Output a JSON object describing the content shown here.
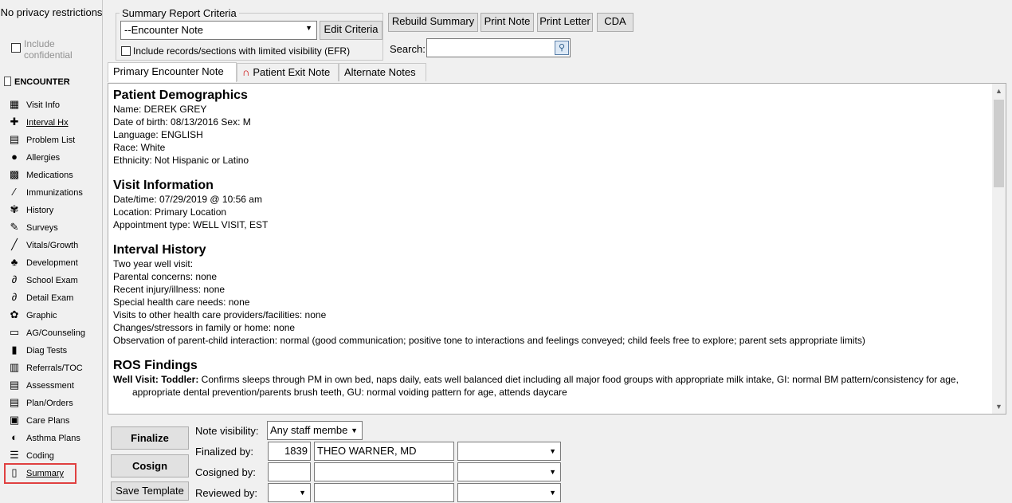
{
  "sidebar": {
    "privacy_text": "No privacy restrictions",
    "include_confidential": "Include confidential",
    "section_title": "ENCOUNTER",
    "items": [
      {
        "label": "Visit Info",
        "icon": "visit-info-icon",
        "glyph": "▦"
      },
      {
        "label": "Interval Hx",
        "icon": "interval-hx-icon",
        "glyph": "✚"
      },
      {
        "label": "Problem List",
        "icon": "problem-list-icon",
        "glyph": "▤"
      },
      {
        "label": "Allergies",
        "icon": "allergies-icon",
        "glyph": "●"
      },
      {
        "label": "Medications",
        "icon": "medications-icon",
        "glyph": "▩"
      },
      {
        "label": "Immunizations",
        "icon": "immunizations-icon",
        "glyph": "⁄"
      },
      {
        "label": "History",
        "icon": "history-icon",
        "glyph": "✾"
      },
      {
        "label": "Surveys",
        "icon": "surveys-icon",
        "glyph": "✎"
      },
      {
        "label": "Vitals/Growth",
        "icon": "vitals-icon",
        "glyph": "╱"
      },
      {
        "label": "Development",
        "icon": "development-icon",
        "glyph": "♣"
      },
      {
        "label": "School Exam",
        "icon": "stethoscope-icon",
        "glyph": "∂"
      },
      {
        "label": "Detail Exam",
        "icon": "stethoscope-icon",
        "glyph": "∂"
      },
      {
        "label": "Graphic",
        "icon": "graphic-icon",
        "glyph": "✿"
      },
      {
        "label": "AG/Counseling",
        "icon": "counseling-icon",
        "glyph": "▭"
      },
      {
        "label": "Diag Tests",
        "icon": "test-tubes-icon",
        "glyph": "▮"
      },
      {
        "label": "Referrals/TOC",
        "icon": "referrals-icon",
        "glyph": "▥"
      },
      {
        "label": "Assessment",
        "icon": "assessment-icon",
        "glyph": "▤"
      },
      {
        "label": "Plan/Orders",
        "icon": "plan-orders-icon",
        "glyph": "▤"
      },
      {
        "label": "Care Plans",
        "icon": "care-plans-icon",
        "glyph": "▣"
      },
      {
        "label": "Asthma Plans",
        "icon": "asthma-plans-icon",
        "glyph": "◐"
      },
      {
        "label": "Coding",
        "icon": "coding-icon",
        "glyph": "☰"
      },
      {
        "label": "Summary",
        "icon": "summary-icon",
        "glyph": "▯"
      }
    ]
  },
  "criteria": {
    "legend": "Summary Report Criteria",
    "selected": "--Encounter Note",
    "edit_button": "Edit Criteria",
    "efr_label": "Include records/sections with limited visibility (EFR)"
  },
  "toolbar": {
    "rebuild": "Rebuild Summary",
    "print_note": "Print Note",
    "print_letter": "Print Letter",
    "cda": "CDA",
    "search_label": "Search:"
  },
  "tabs": {
    "primary": "Primary Encounter Note",
    "exit": "Patient Exit Note",
    "alternate": "Alternate Notes"
  },
  "note": {
    "demographics": {
      "title": "Patient Demographics",
      "name": "Name: DEREK GREY",
      "dob": "Date of birth: 08/13/2016   Sex: M",
      "language": "Language: ENGLISH",
      "race": "Race: White",
      "ethnicity": "Ethnicity: Not Hispanic or Latino"
    },
    "visit": {
      "title": "Visit Information",
      "datetime": "Date/time: 07/29/2019 @ 10:56 am",
      "location": "Location: Primary Location",
      "appt": "Appointment type: WELL VISIT, EST"
    },
    "interval": {
      "title": "Interval History",
      "l1": "Two year well visit:",
      "l2": "Parental concerns: none",
      "l3": "Recent injury/illness: none",
      "l4": "Special health care needs:  none",
      "l5": "Visits to other health care providers/facilities:  none",
      "l6": "Changes/stressors in family or home: none",
      "l7": "Observation of parent-child interaction: normal (good communication; positive tone to interactions and feelings conveyed; child feels free to explore; parent sets appropriate limits)"
    },
    "ros": {
      "title": "ROS Findings",
      "bold": "Well Visit: Toddler:",
      "text": " Confirms sleeps through PM in own bed, naps daily, eats well balanced diet including all major food groups with appropriate milk intake, GI: normal BM pattern/consistency for age, appropriate dental prevention/parents brush teeth, GU: normal voiding pattern for age, attends daycare"
    }
  },
  "bottom": {
    "finalize": "Finalize",
    "cosign": "Cosign",
    "save_template": "Save Template",
    "note_visibility_label": "Note visibility:",
    "note_visibility_value": "Any staff membe",
    "finalized_by_label": "Finalized by:",
    "finalized_id": "1839",
    "finalized_name": "THEO WARNER, MD",
    "cosigned_by_label": "Cosigned by:",
    "reviewed_by_label": "Reviewed by:"
  }
}
